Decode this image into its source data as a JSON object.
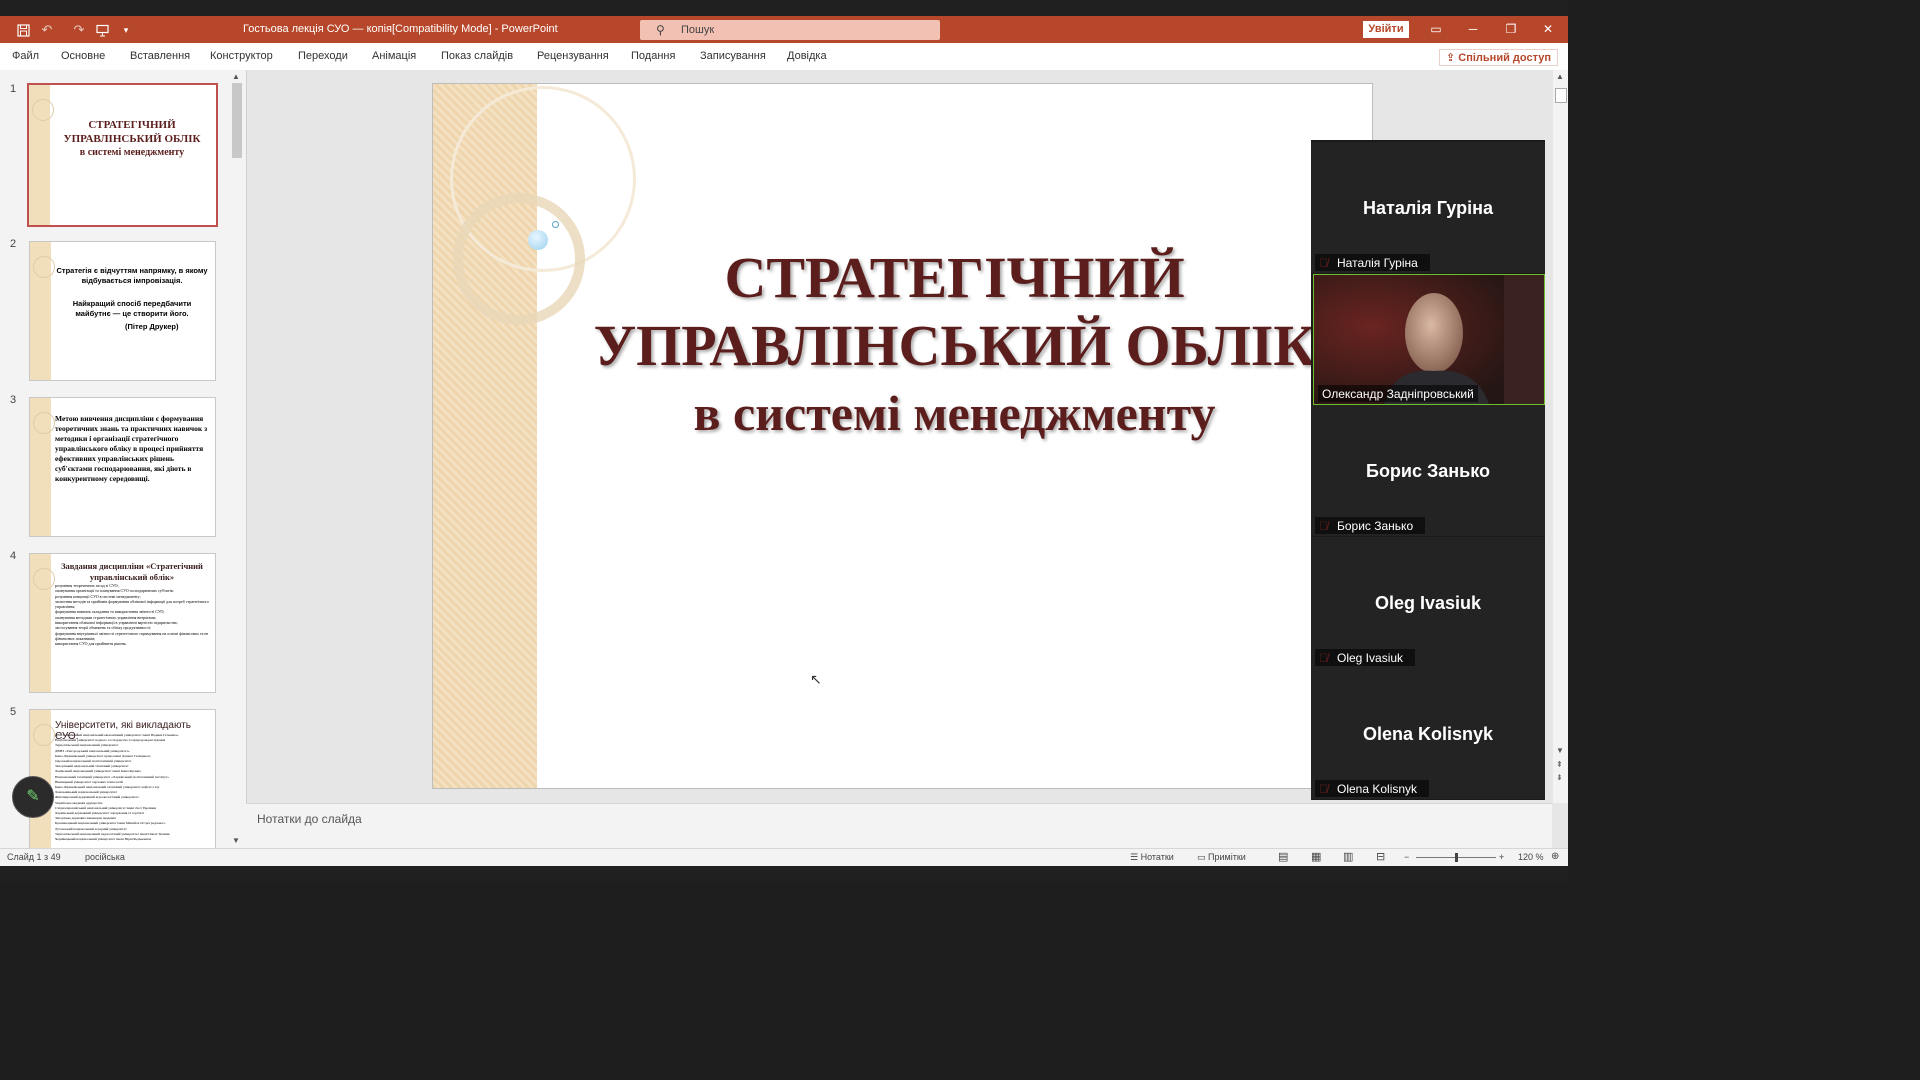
{
  "window": {
    "title": "Гостьова лекція СУО — копія[Compatibility Mode]  -  PowerPoint",
    "search_placeholder": "Пошук",
    "signin_label": "Увійти",
    "share_label": "Спільний доступ",
    "accent_color": "#b7472a"
  },
  "ribbon_tabs": [
    "Файл",
    "Основне",
    "Вставлення",
    "Конструктор",
    "Переходи",
    "Анімація",
    "Показ слайдів",
    "Рецензування",
    "Подання",
    "Записування",
    "Довідка"
  ],
  "thumbnails": [
    {
      "num": "1",
      "lines": [
        "СТРАТЕГІЧНИЙ",
        "УПРАВЛІНСЬКИЙ ОБЛІК",
        "в системі менеджменту"
      ]
    },
    {
      "num": "2",
      "text1": "Стратегія є відчуттям напрямку, в якому відбувається імпровізація.",
      "text2": "Найкращий спосіб передбачити майбутнє — це створити його.",
      "text3": "(Пітер Друкер)"
    },
    {
      "num": "3",
      "text": "Метою вивчення дисципліни є формування теоретичних знань та практичних навичок з методики і організації стратегічного управлінського обліку в процесі прийняття ефективних управлінських рішень суб'єктами господарювання, які діють в конкурентному середовищі."
    },
    {
      "num": "4",
      "title": "Завдання дисципліни «Стратегічний управлінський облік»",
      "bullets": [
        "розуміння теоретичних засад зі СУО;",
        "опанування організації та планування СУО господарюючих суб'єктів;",
        "розуміння концепції СУО в системі менеджменту;",
        "засвоєння методів та прийомів формування облікової інформації для потреб стратегічного управління;",
        "формування навичок складання та використання звітності СУО;",
        "опанування методами стратегічного управління витратами;",
        "використання облікової інформації в управлінні вартістю підприємства;",
        "застосування теорії обмежень та обліку продуктивності;",
        "формування внутрішньої звітності стратегічного спрямування на основі фінансових та не фінансових показників;",
        "використання СУО для прийняття рішень."
      ]
    },
    {
      "num": "5",
      "title": "Університети, які викладають СУО:",
      "bullets": [
        "ДВНЗ «Київський національний економічний університет імені Вадима Гетьмана»",
        "Національний університет водного господарства та природокористування",
        "Тернопільський національний університет",
        "ДВНЗ «Ужгородський національний університет»",
        "Івано-Франківський університет права імені Данила Галицького",
        "Одеський національний політехнічний університет",
        "Запорізький національний технічний університет",
        "Львівський національний університет імені Івана Франка",
        "Національний технічний університет «Харківський політехнічний інститут»",
        "Вінницький університет харчових технологій",
        "Івано-Франківський національний технічний університет нафти і газу",
        "Хмельницький національний університет",
        "Житомирський державний агроекологічний університет",
        "Українська академія друкарства",
        "Східноєвропейський національний університет імені Лесі Українки",
        "Харківський державний університет харчування та торгівлі",
        "Запорізька державна інженерна академія",
        "Кременецький національний університет імені Михайла Остроградського",
        "Луганський національний аграрний університет",
        "Тернопільський національний педагогічний університет імені Павла Тичини",
        "Чернівецький національний університет імені Юрія Федьковича"
      ]
    }
  ],
  "slide": {
    "line1": "СТРАТЕГІЧНИЙ",
    "line2": "УПРАВЛІНСЬКИЙ ОБЛІК",
    "line3": "в системі менеджменту",
    "title_color": "#5b1e1c"
  },
  "notes_placeholder": "Нотатки до слайда",
  "status": {
    "slide_counter": "Слайд 1 з 49",
    "language": "російська",
    "notes": "Нотатки",
    "comments": "Примітки",
    "zoom": "120 %"
  },
  "participants": [
    {
      "name": "Наталія Гуріна",
      "video": false,
      "muted": true
    },
    {
      "name": "Олександр Задніпровський",
      "video": true,
      "muted": false
    },
    {
      "name": "Борис Занько",
      "video": false,
      "muted": true
    },
    {
      "name": "Oleg Ivasiuk",
      "video": false,
      "muted": true
    },
    {
      "name": "Olena Kolisnyk",
      "video": false,
      "muted": true
    }
  ]
}
